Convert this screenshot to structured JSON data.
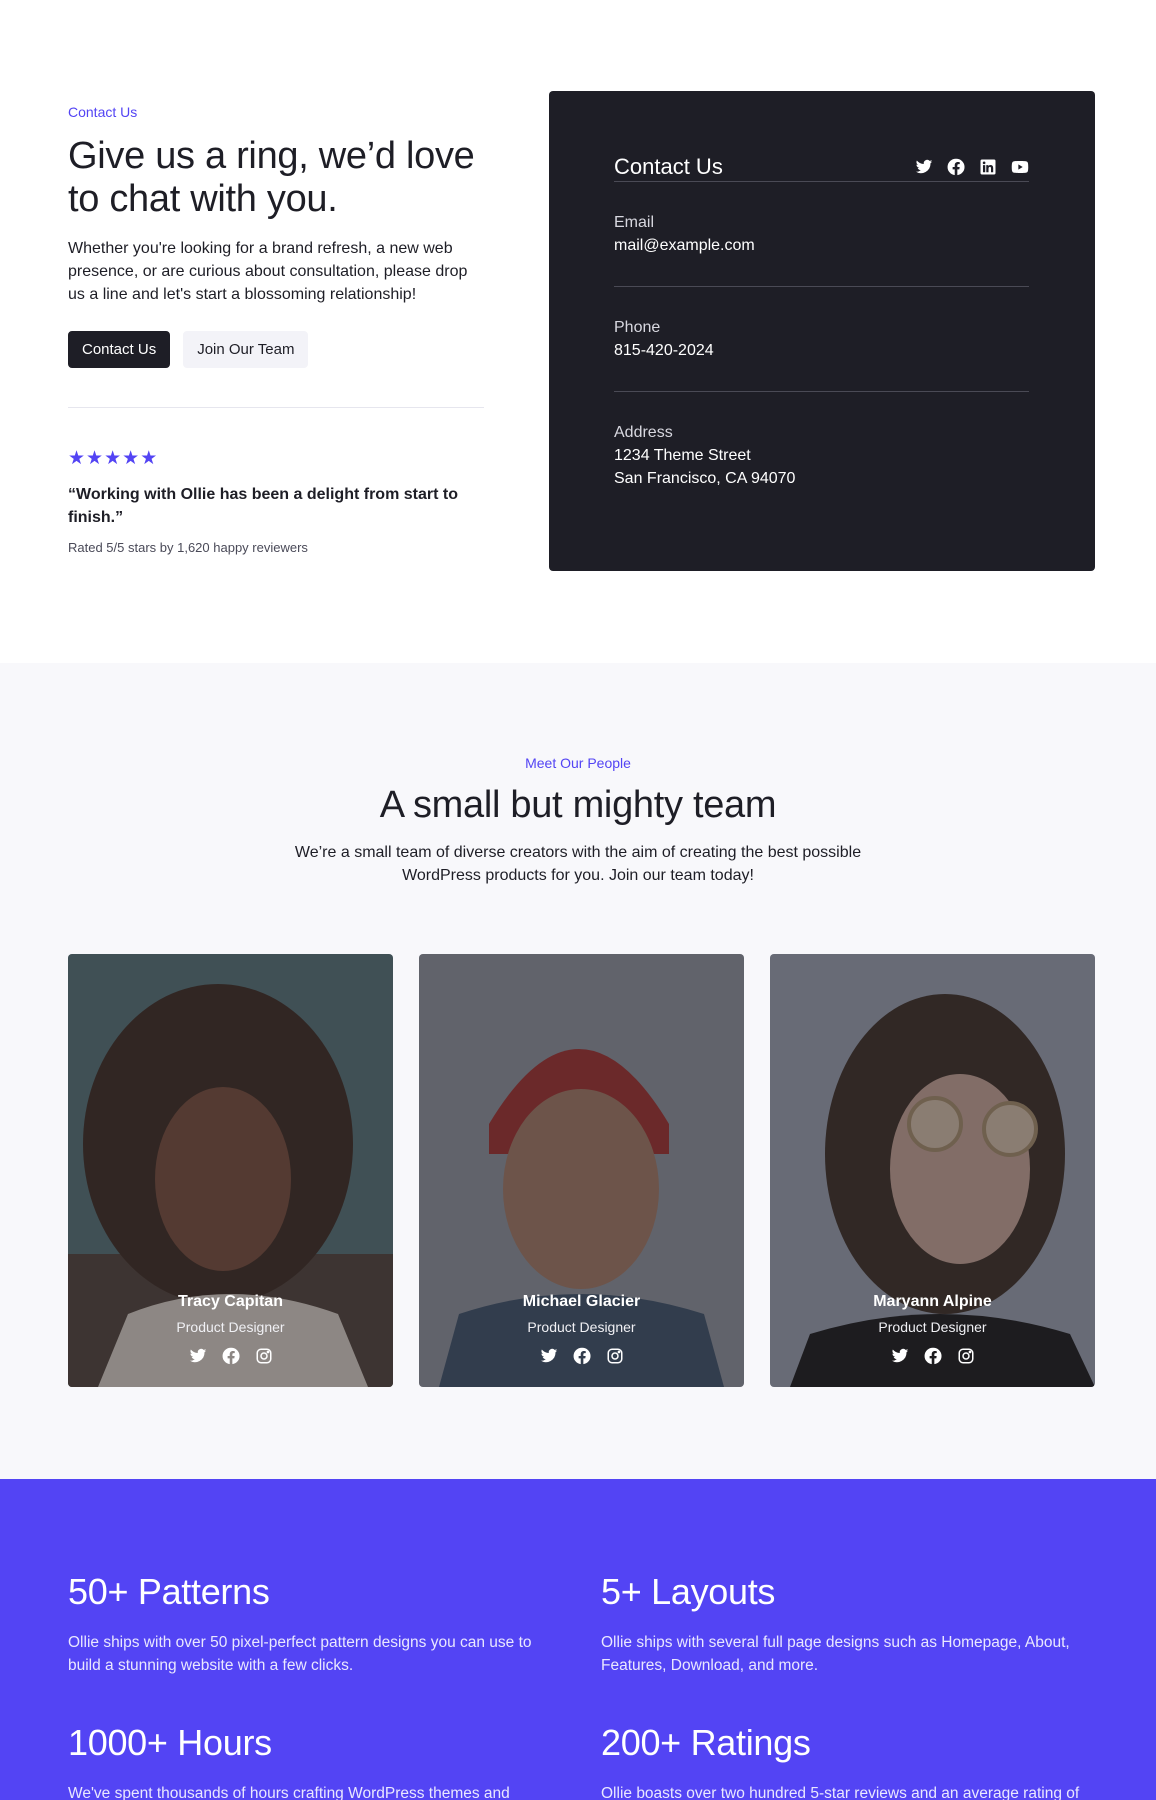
{
  "contact": {
    "eyebrow": "Contact Us",
    "title": "Give us a ring, we’d love to chat with you.",
    "description": "Whether you're looking for a brand refresh, a new web presence, or are curious about consultation, please drop us a line and let's start a blossoming relationship!",
    "primary_button": "Contact Us",
    "secondary_button": "Join Our Team",
    "stars": [
      "★",
      "★",
      "★",
      "★",
      "★"
    ],
    "quote": "“Working with Ollie has been a delight from start to finish.”",
    "rating_note": "Rated 5/5 stars by 1,620 happy reviewers"
  },
  "card": {
    "title": "Contact Us",
    "social_icons": [
      "twitter-icon",
      "facebook-icon",
      "linkedin-icon",
      "youtube-icon"
    ],
    "email_label": "Email",
    "email_value": "mail@example.com",
    "phone_label": "Phone",
    "phone_value": "815-420-2024",
    "address_label": "Address",
    "address_line1": "1234 Theme Street",
    "address_line2": "San Francisco, CA 94070"
  },
  "team": {
    "eyebrow": "Meet Our People",
    "title": "A small but mighty team",
    "description": "We’re a small team of diverse creators with the aim of creating the best possible WordPress products for you. Join our team today!",
    "members": [
      {
        "name": "Tracy Capitan",
        "role": "Product Designer",
        "social_icons": [
          "twitter-icon",
          "facebook-icon",
          "instagram-icon"
        ]
      },
      {
        "name": "Michael Glacier",
        "role": "Product Designer",
        "social_icons": [
          "twitter-icon",
          "facebook-icon",
          "instagram-icon"
        ]
      },
      {
        "name": "Maryann Alpine",
        "role": "Product Designer",
        "social_icons": [
          "twitter-icon",
          "facebook-icon",
          "instagram-icon"
        ]
      }
    ]
  },
  "stats": [
    {
      "title": "50+ Patterns",
      "text": "Ollie ships with over 50 pixel-perfect pattern designs you can use to build a stunning website with a few clicks."
    },
    {
      "title": "5+ Layouts",
      "text": "Ollie ships with several full page designs such as Homepage, About, Features, Download, and more."
    },
    {
      "title": "1000+ Hours",
      "text": "We've spent thousands of hours crafting WordPress themes and"
    },
    {
      "title": "200+ Ratings",
      "text": "Ollie boasts over two hundred 5-star reviews and an average rating of"
    }
  ],
  "colors": {
    "accent": "#5344f4",
    "dark": "#1e1e26",
    "light_bg": "#f8f8fb"
  }
}
